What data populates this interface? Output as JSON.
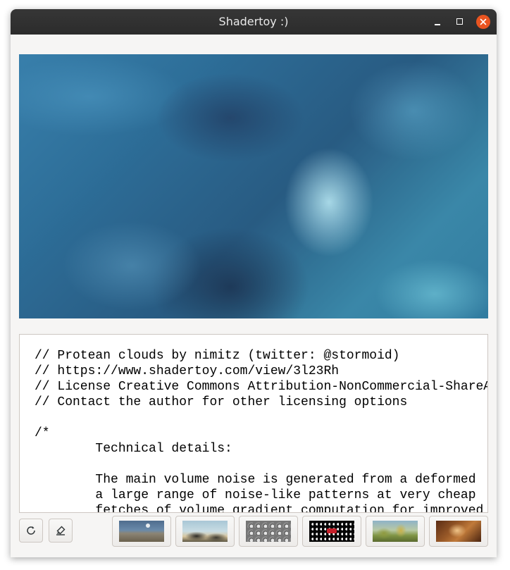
{
  "window": {
    "title": "Shadertoy :)"
  },
  "titlebar_buttons": {
    "minimize": "minimize-icon",
    "maximize": "maximize-icon",
    "close": "close-icon",
    "close_color": "#e95420"
  },
  "code_panel": {
    "lines": [
      "// Protean clouds by nimitz (twitter: @stormoid)",
      "// https://www.shadertoy.com/view/3l23Rh",
      "// License Creative Commons Attribution-NonCommercial-ShareAlike",
      "// Contact the author for other licensing options",
      "",
      "/*",
      "        Technical details:",
      "",
      "        The main volume noise is generated from a deformed",
      "        a large range of noise-like patterns at very cheap",
      "        fetches of volume gradient computation for improved"
    ]
  },
  "toolbar": {
    "reload_icon": "reload-icon",
    "edit_icon": "eraser-icon",
    "presets": [
      {
        "name": "landscape-planet"
      },
      {
        "name": "rocky-coast"
      },
      {
        "name": "hex-pattern"
      },
      {
        "name": "black-dots"
      },
      {
        "name": "cartoon-landscape"
      },
      {
        "name": "warm-tunnel"
      }
    ]
  }
}
